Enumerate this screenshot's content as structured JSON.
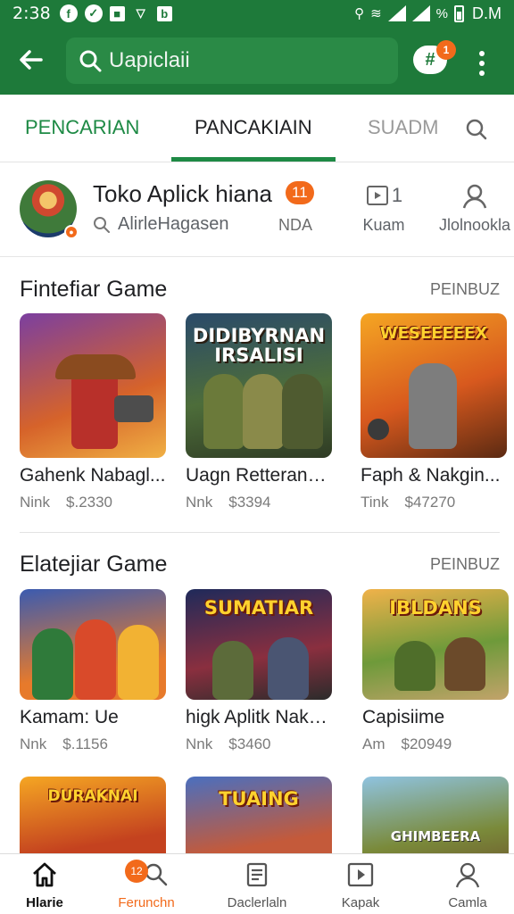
{
  "status_bar": {
    "time": "2:38",
    "signal_text": "%",
    "carrier": "D.M"
  },
  "app_bar": {
    "search_placeholder": "Uapiclaii",
    "notification_count": "1"
  },
  "tabs": [
    {
      "label": "PENCARIAN"
    },
    {
      "label": "PANCAKIAIN"
    },
    {
      "label": "SUADM"
    }
  ],
  "developer": {
    "name": "Toko Aplick hiana",
    "badge": "11",
    "subtitle": "AlirleHagasen",
    "tag": "NDA",
    "stats": [
      {
        "value": "1",
        "label": "Kuam"
      },
      {
        "label": "Jlolnookla"
      }
    ]
  },
  "sections": [
    {
      "title": "Fintefiar Game",
      "more": "PEINBUZ",
      "apps": [
        {
          "name": "Gahenk Nabagl...",
          "tag": "Nink",
          "price": "$.2330",
          "art": "cowboy"
        },
        {
          "name": "Uagn Retterangl...",
          "tag": "Nnk",
          "price": "$3394",
          "art_text": "DIDIBYRNAN IRSALISI"
        },
        {
          "name": "Faph & Nakgin...",
          "tag": "Tink",
          "price": "$47270",
          "art_text": "WESEEEEEX"
        }
      ]
    },
    {
      "title": "Elatejiar Game",
      "more": "PEINBUZ",
      "apps": [
        {
          "name": "Kamam: Ue",
          "tag": "Nnk",
          "price": "$.1156",
          "art": "heroes"
        },
        {
          "name": "higk Aplitk Nakay...",
          "tag": "Nnk",
          "price": "$3460",
          "art_text": "SUMATIAR"
        },
        {
          "name": "Capisiime",
          "tag": "Am",
          "price": "$20949",
          "art_text": "IBLDANS"
        }
      ]
    },
    {
      "title": "",
      "apps": [
        {
          "art_text": "DURAKNAI"
        },
        {
          "art_text": "TUAING"
        },
        {
          "art_text": "GHIMBEERA"
        }
      ]
    }
  ],
  "bottom_nav": [
    {
      "label": "Hlarie",
      "icon": "home-icon"
    },
    {
      "label": "Ferunchn",
      "icon": "search-icon",
      "badge": "12"
    },
    {
      "label": "Daclerlaln",
      "icon": "library-icon"
    },
    {
      "label": "Kapak",
      "icon": "play-icon"
    },
    {
      "label": "Camla",
      "icon": "person-icon"
    }
  ],
  "colors": {
    "brand_green": "#1e7a3a",
    "accent_orange": "#f26a1b"
  }
}
